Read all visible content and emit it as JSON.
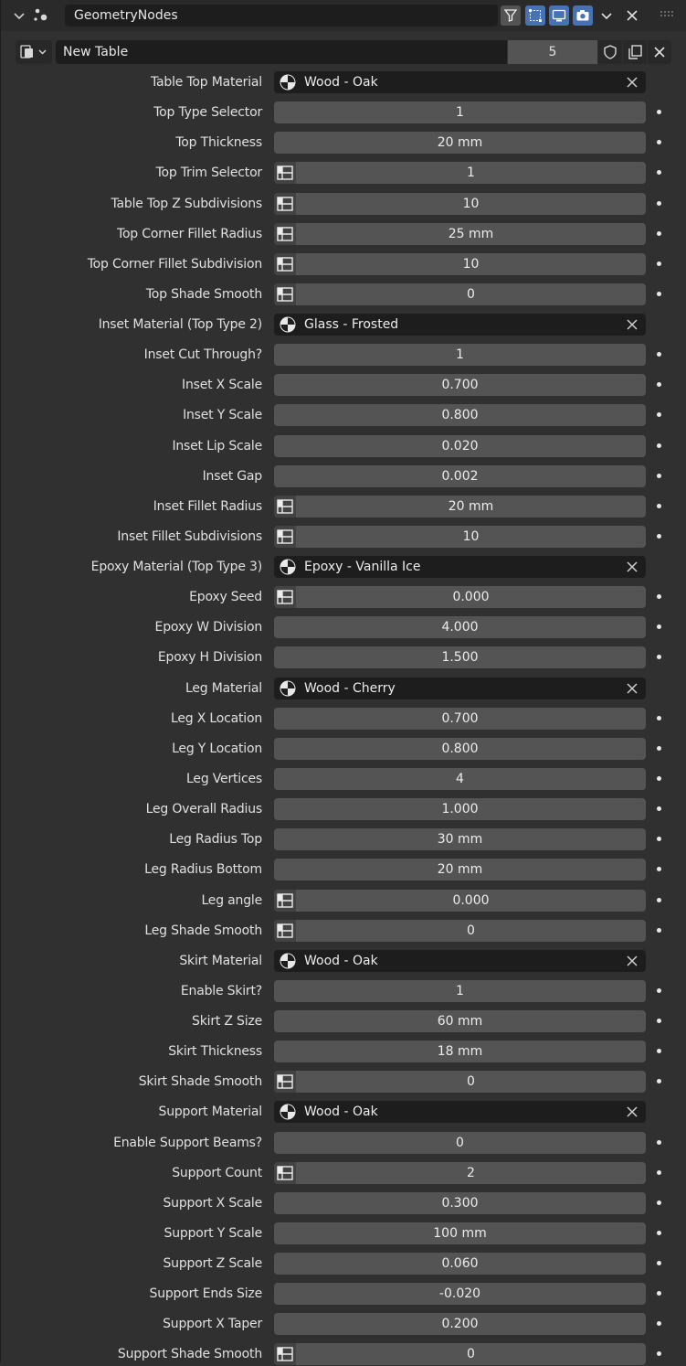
{
  "header": {
    "modifier_name": "GeometryNodes",
    "icons": [
      "chevron-down-icon",
      "geometry-nodes-icon",
      "filter-icon",
      "edit-mode-icon",
      "viewport-icon",
      "render-icon",
      "chevron-down-icon",
      "close-icon",
      "grip-icon"
    ]
  },
  "node_group": {
    "name": "New Table",
    "users": "5"
  },
  "colors": {
    "panel": "#303030",
    "field": "#545454",
    "dark_field": "#1d1d1d",
    "accent": "#4772b3"
  },
  "rows": [
    {
      "label": "Table Top Material",
      "kind": "material",
      "value": "Wood - Oak"
    },
    {
      "label": "Top Type Selector",
      "kind": "value",
      "value": "1"
    },
    {
      "label": "Top Thickness",
      "kind": "value",
      "value": "20 mm"
    },
    {
      "label": "Top Trim Selector",
      "kind": "attr",
      "value": "1"
    },
    {
      "label": "Table Top Z Subdivisions",
      "kind": "attr",
      "value": "10"
    },
    {
      "label": "Top Corner Fillet Radius",
      "kind": "attr",
      "value": "25 mm"
    },
    {
      "label": "Top Corner Fillet Subdivision",
      "kind": "attr",
      "value": "10"
    },
    {
      "label": "Top Shade Smooth",
      "kind": "attr",
      "value": "0"
    },
    {
      "label": "Inset Material (Top Type 2)",
      "kind": "material",
      "value": "Glass - Frosted"
    },
    {
      "label": "Inset Cut Through?",
      "kind": "value",
      "value": "1"
    },
    {
      "label": "Inset X Scale",
      "kind": "value",
      "value": "0.700"
    },
    {
      "label": "Inset Y Scale",
      "kind": "value",
      "value": "0.800"
    },
    {
      "label": "Inset Lip Scale",
      "kind": "value",
      "value": "0.020"
    },
    {
      "label": "Inset Gap",
      "kind": "value",
      "value": "0.002"
    },
    {
      "label": "Inset Fillet Radius",
      "kind": "attr",
      "value": "20 mm"
    },
    {
      "label": "Inset Fillet Subdivisions",
      "kind": "attr",
      "value": "10"
    },
    {
      "label": "Epoxy Material (Top Type 3)",
      "kind": "material",
      "value": "Epoxy - Vanilla Ice"
    },
    {
      "label": "Epoxy Seed",
      "kind": "attr",
      "value": "0.000"
    },
    {
      "label": "Epoxy W Division",
      "kind": "value",
      "value": "4.000"
    },
    {
      "label": "Epoxy H Division",
      "kind": "value",
      "value": "1.500"
    },
    {
      "label": "Leg Material",
      "kind": "material",
      "value": "Wood - Cherry"
    },
    {
      "label": "Leg X Location",
      "kind": "value",
      "value": "0.700"
    },
    {
      "label": "Leg Y Location",
      "kind": "value",
      "value": "0.800"
    },
    {
      "label": "Leg Vertices",
      "kind": "value",
      "value": "4"
    },
    {
      "label": "Leg Overall Radius",
      "kind": "value",
      "value": "1.000"
    },
    {
      "label": "Leg Radius Top",
      "kind": "value",
      "value": "30 mm"
    },
    {
      "label": "Leg Radius Bottom",
      "kind": "value",
      "value": "20 mm"
    },
    {
      "label": "Leg angle",
      "kind": "attr",
      "value": "0.000"
    },
    {
      "label": "Leg Shade Smooth",
      "kind": "attr",
      "value": "0"
    },
    {
      "label": "Skirt Material",
      "kind": "material",
      "value": "Wood - Oak"
    },
    {
      "label": "Enable Skirt?",
      "kind": "value",
      "value": "1"
    },
    {
      "label": "Skirt Z Size",
      "kind": "value",
      "value": "60 mm"
    },
    {
      "label": "Skirt Thickness",
      "kind": "value",
      "value": "18 mm"
    },
    {
      "label": "Skirt Shade Smooth",
      "kind": "attr",
      "value": "0"
    },
    {
      "label": "Support Material",
      "kind": "material",
      "value": "Wood - Oak"
    },
    {
      "label": "Enable Support Beams?",
      "kind": "value",
      "value": "0"
    },
    {
      "label": "Support Count",
      "kind": "attr",
      "value": "2"
    },
    {
      "label": "Support X Scale",
      "kind": "value",
      "value": "0.300"
    },
    {
      "label": "Support Y Scale",
      "kind": "value",
      "value": "100 mm"
    },
    {
      "label": "Support Z Scale",
      "kind": "value",
      "value": "0.060"
    },
    {
      "label": "Support Ends Size",
      "kind": "value",
      "value": "-0.020"
    },
    {
      "label": "Support X Taper",
      "kind": "value",
      "value": "0.200"
    },
    {
      "label": "Support Shade Smooth",
      "kind": "attr",
      "value": "0"
    }
  ]
}
